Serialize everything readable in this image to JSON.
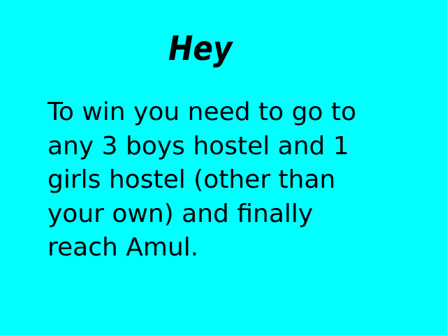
{
  "screen": {
    "title": "Hey",
    "message_lines": [
      "To win you need to go to",
      "any 3 boys hostel and 1",
      "girls hostel (other than",
      "your own) and finally",
      "reach Amul."
    ]
  },
  "colors": {
    "background": "#00ffff",
    "text": "#000000"
  }
}
